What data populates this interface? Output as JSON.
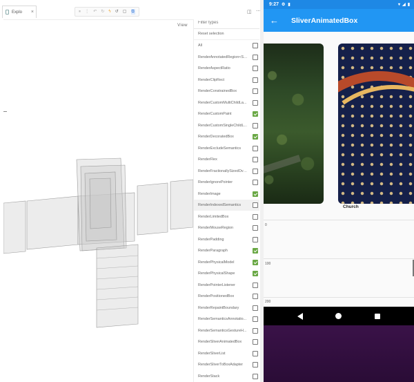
{
  "ide": {
    "tab_label": "Explo",
    "toolbar_icons": [
      "pause-icon",
      "step-icon",
      "step-back-icon",
      "refresh-icon",
      "lightning-icon",
      "undo-icon",
      "square-icon",
      "select-icon"
    ],
    "view_label": "View"
  },
  "filter": {
    "placeholder": "Filter types",
    "reset_label": "Reset selection",
    "items": [
      {
        "label": "All",
        "checked": false
      },
      {
        "label": "RenderAnnotatedRegion<Sy...",
        "checked": false
      },
      {
        "label": "RenderAspectRatio",
        "checked": false
      },
      {
        "label": "RenderClipRect",
        "checked": false
      },
      {
        "label": "RenderConstrainedBox",
        "checked": false
      },
      {
        "label": "RenderCustomMultiChildLa...",
        "checked": false
      },
      {
        "label": "RenderCustomPaint",
        "checked": true
      },
      {
        "label": "RenderCustomSingleChildL...",
        "checked": false
      },
      {
        "label": "RenderDecoratedBox",
        "checked": true
      },
      {
        "label": "RenderExcludeSemantics",
        "checked": false
      },
      {
        "label": "RenderFlex",
        "checked": false
      },
      {
        "label": "RenderFractionallySizedOve...",
        "checked": false
      },
      {
        "label": "RenderIgnorePointer",
        "checked": false
      },
      {
        "label": "RenderImage",
        "checked": true
      },
      {
        "label": "RenderIndexedSemantics",
        "checked": false,
        "highlight": true
      },
      {
        "label": "RenderLimitedBox",
        "checked": false
      },
      {
        "label": "RenderMouseRegion",
        "checked": false
      },
      {
        "label": "RenderPadding",
        "checked": false
      },
      {
        "label": "RenderParagraph",
        "checked": true
      },
      {
        "label": "RenderPhysicalModel",
        "checked": true
      },
      {
        "label": "RenderPhysicalShape",
        "checked": true
      },
      {
        "label": "RenderPointerListener",
        "checked": false
      },
      {
        "label": "RenderPositionedBox",
        "checked": false
      },
      {
        "label": "RenderRepaintBoundary",
        "checked": false
      },
      {
        "label": "RenderSemanticsAnnotatio...",
        "checked": false
      },
      {
        "label": "RenderSemanticsGestureH...",
        "checked": false
      },
      {
        "label": "RenderSliverAnimatedBox",
        "checked": false
      },
      {
        "label": "RenderSliverList",
        "checked": false
      },
      {
        "label": "RenderSliverToBoxAdapter",
        "checked": false
      },
      {
        "label": "RenderStack",
        "checked": false
      }
    ]
  },
  "phone": {
    "time": "9:27",
    "title": "SliverAnimatedBox",
    "caption": "Church",
    "graph_labels": [
      "0",
      "100",
      "200"
    ],
    "colors": {
      "appbar": "#2196f3",
      "statusbar": "#1e88e5",
      "check": "#6aa845"
    }
  }
}
